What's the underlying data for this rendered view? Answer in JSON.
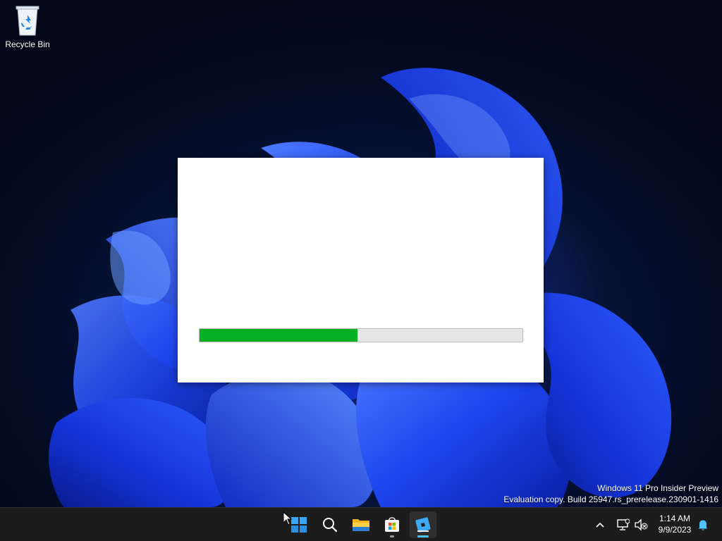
{
  "desktop": {
    "icons": [
      {
        "label": "Recycle Bin",
        "icon": "recycle-bin-icon"
      }
    ],
    "watermark": {
      "line1": "Windows 11 Pro Insider Preview",
      "line2": "Evaluation copy. Build 25947.rs_prerelease.230901-1416"
    }
  },
  "splash_window": {
    "progress_fraction": 0.49,
    "progress_color": "#06b025",
    "track_color": "#e6e6e6"
  },
  "taskbar": {
    "apps": [
      {
        "icon": "start-icon",
        "running": false
      },
      {
        "icon": "search-icon",
        "running": false
      },
      {
        "icon": "file-explorer-icon",
        "running": false
      },
      {
        "icon": "microsoft-store-icon",
        "running": true
      },
      {
        "icon": "roblox-icon",
        "running": true,
        "active": true
      }
    ],
    "tray": {
      "icons": [
        "chevron-up-icon",
        "network-icon",
        "volume-muted-icon",
        "notification-bell-icon"
      ],
      "time": "1:14 AM",
      "date": "9/9/2023"
    }
  },
  "colors": {
    "accent": "#4cc2ff",
    "taskbar_bg": "#1c1c1c",
    "desktop_bloom": "#1f4dff"
  }
}
